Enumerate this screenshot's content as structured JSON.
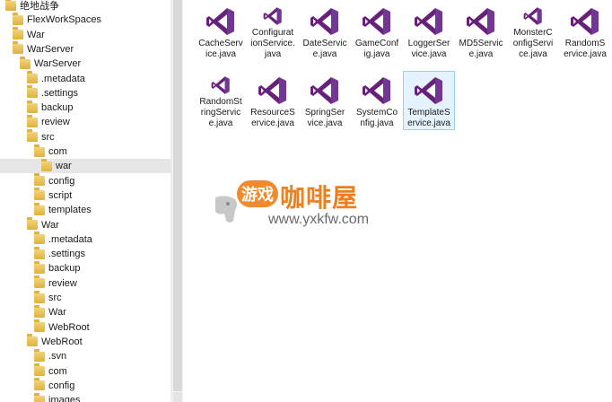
{
  "tree": {
    "items": [
      {
        "label": "绝地战争",
        "depth": 0
      },
      {
        "label": "FlexWorkSpaces",
        "depth": 1
      },
      {
        "label": "War",
        "depth": 1
      },
      {
        "label": "WarServer",
        "depth": 1
      },
      {
        "label": "WarServer",
        "depth": 2
      },
      {
        "label": ".metadata",
        "depth": 3
      },
      {
        "label": ".settings",
        "depth": 3
      },
      {
        "label": "backup",
        "depth": 3
      },
      {
        "label": "review",
        "depth": 3
      },
      {
        "label": "src",
        "depth": 3
      },
      {
        "label": "com",
        "depth": 4
      },
      {
        "label": "war",
        "depth": 5,
        "selected": true
      },
      {
        "label": "config",
        "depth": 4
      },
      {
        "label": "script",
        "depth": 4
      },
      {
        "label": "templates",
        "depth": 4
      },
      {
        "label": "War",
        "depth": 3
      },
      {
        "label": ".metadata",
        "depth": 4
      },
      {
        "label": ".settings",
        "depth": 4
      },
      {
        "label": "backup",
        "depth": 4
      },
      {
        "label": "review",
        "depth": 4
      },
      {
        "label": "src",
        "depth": 4
      },
      {
        "label": "War",
        "depth": 4
      },
      {
        "label": "WebRoot",
        "depth": 4
      },
      {
        "label": "WebRoot",
        "depth": 3
      },
      {
        "label": ".svn",
        "depth": 4
      },
      {
        "label": "com",
        "depth": 4
      },
      {
        "label": "config",
        "depth": 4
      },
      {
        "label": "images",
        "depth": 4
      }
    ]
  },
  "files": [
    {
      "name": "CacheService.java",
      "lines": [
        "CacheServ",
        "ice.java"
      ]
    },
    {
      "name": "ConfigurationService.java",
      "lines": [
        "Configurat",
        "ionService.",
        "java"
      ]
    },
    {
      "name": "DateService.java",
      "lines": [
        "DateServic",
        "e.java"
      ]
    },
    {
      "name": "GameConfig.java",
      "lines": [
        "GameConf",
        "ig.java"
      ]
    },
    {
      "name": "LoggerService.java",
      "lines": [
        "LoggerSer",
        "vice.java"
      ]
    },
    {
      "name": "MD5Service.java",
      "lines": [
        "MD5Servic",
        "e.java"
      ]
    },
    {
      "name": "MonsterConfigService.java",
      "lines": [
        "MonsterC",
        "onfigServi",
        "ce.java"
      ]
    },
    {
      "name": "RandomService.java",
      "lines": [
        "RandomS",
        "ervice.java"
      ]
    },
    {
      "name": "RandomStringService.java",
      "lines": [
        "RandomSt",
        "ringServic",
        "e.java"
      ]
    },
    {
      "name": "ResourceService.java",
      "lines": [
        "ResourceS",
        "ervice.java"
      ]
    },
    {
      "name": "SpringService.java",
      "lines": [
        "SpringSer",
        "vice.java"
      ]
    },
    {
      "name": "SystemConfig.java",
      "lines": [
        "SystemCo",
        "nfig.java"
      ]
    },
    {
      "name": "TemplateService.java",
      "lines": [
        "TemplateS",
        "ervice.java"
      ],
      "selected": true
    }
  ],
  "watermark": {
    "badge": "游戏",
    "brand": "咖啡屋",
    "url": "www.yxkfw.com"
  },
  "colors": {
    "vs_purple": "#68217a",
    "vs_purple_light": "#865fc5",
    "selection": "#e5f3ff",
    "selection_border": "#9bd0f5",
    "brand_orange": "#ef7f1e"
  }
}
